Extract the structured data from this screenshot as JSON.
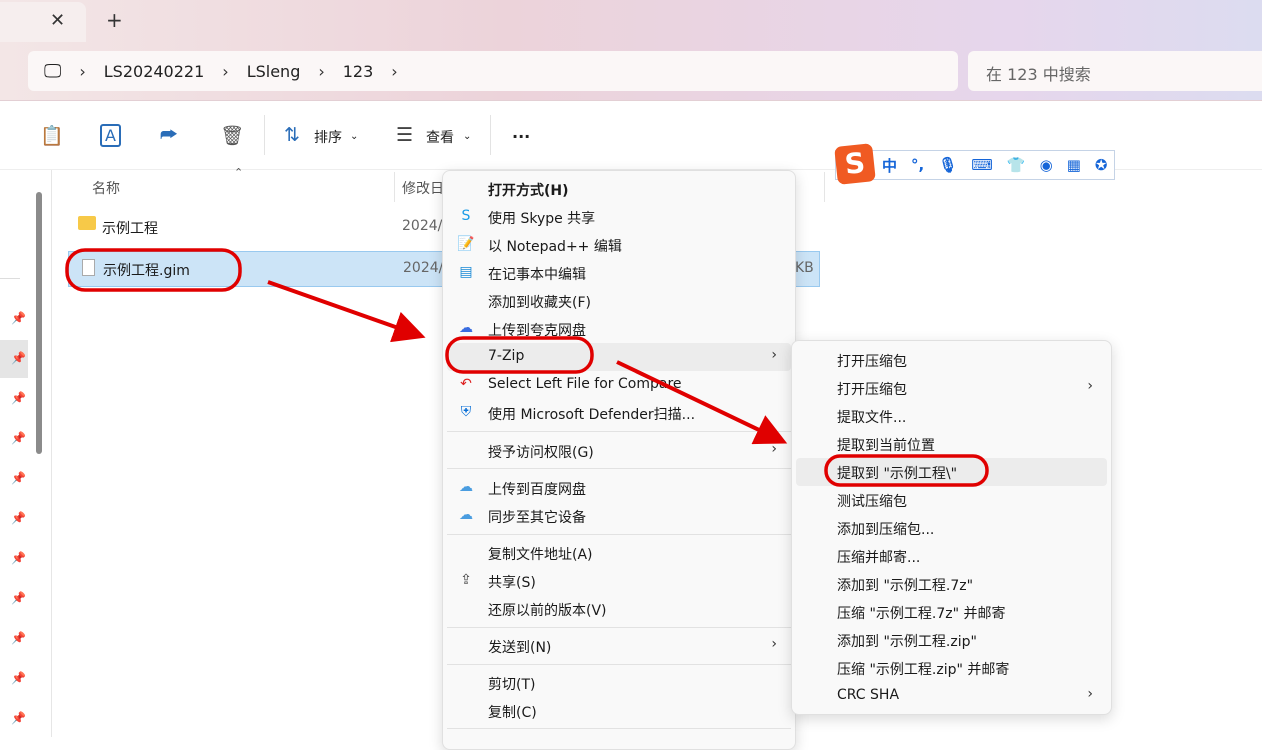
{
  "window": {
    "close_tab": "✕",
    "new_tab": "+"
  },
  "address": {
    "crumbs": [
      "LS20240221",
      "LSleng",
      "123"
    ],
    "sep": "›"
  },
  "search": {
    "placeholder": "在 123 中搜索"
  },
  "toolbar": {
    "sort": "排序",
    "view": "查看",
    "more": "···"
  },
  "columns": {
    "name": "名称",
    "modified": "修改日"
  },
  "files": [
    {
      "name": "示例工程",
      "date": "2024/",
      "size": ""
    },
    {
      "name": "示例工程.gim",
      "date": "2024/",
      "size": "KB"
    }
  ],
  "ime": {
    "logo": "S",
    "items": [
      "中",
      "°,"
    ]
  },
  "context_menu": {
    "items": [
      {
        "label": "打开方式(H)",
        "bold": true
      },
      {
        "label": "使用 Skype 共享"
      },
      {
        "label": "以 Notepad++ 编辑"
      },
      {
        "label": "在记事本中编辑"
      },
      {
        "label": "添加到收藏夹(F)"
      },
      {
        "label": "上传到夸克网盘"
      },
      {
        "label": "7-Zip",
        "submenu": true
      },
      {
        "label": "Select Left File for Compare"
      },
      {
        "label": "使用 Microsoft Defender扫描..."
      },
      {
        "label": "授予访问权限(G)",
        "submenu": true
      },
      {
        "label": "上传到百度网盘"
      },
      {
        "label": "同步至其它设备"
      },
      {
        "label": "复制文件地址(A)"
      },
      {
        "label": "共享(S)"
      },
      {
        "label": "还原以前的版本(V)"
      },
      {
        "label": "发送到(N)",
        "submenu": true
      },
      {
        "label": "剪切(T)"
      },
      {
        "label": "复制(C)"
      }
    ]
  },
  "submenu_7zip": {
    "items": [
      {
        "label": "打开压缩包"
      },
      {
        "label": "打开压缩包",
        "submenu": true
      },
      {
        "label": "提取文件..."
      },
      {
        "label": "提取到当前位置"
      },
      {
        "label": "提取到 \"示例工程\\\""
      },
      {
        "label": "测试压缩包"
      },
      {
        "label": "添加到压缩包..."
      },
      {
        "label": "压缩并邮寄..."
      },
      {
        "label": "添加到 \"示例工程.7z\""
      },
      {
        "label": "压缩 \"示例工程.7z\" 并邮寄"
      },
      {
        "label": "添加到 \"示例工程.zip\""
      },
      {
        "label": "压缩 \"示例工程.zip\" 并邮寄"
      },
      {
        "label": "CRC SHA",
        "submenu": true
      }
    ]
  },
  "colors": {
    "annotation": "#e00000",
    "selection": "#cce4f7",
    "accent": "#1565d8"
  }
}
